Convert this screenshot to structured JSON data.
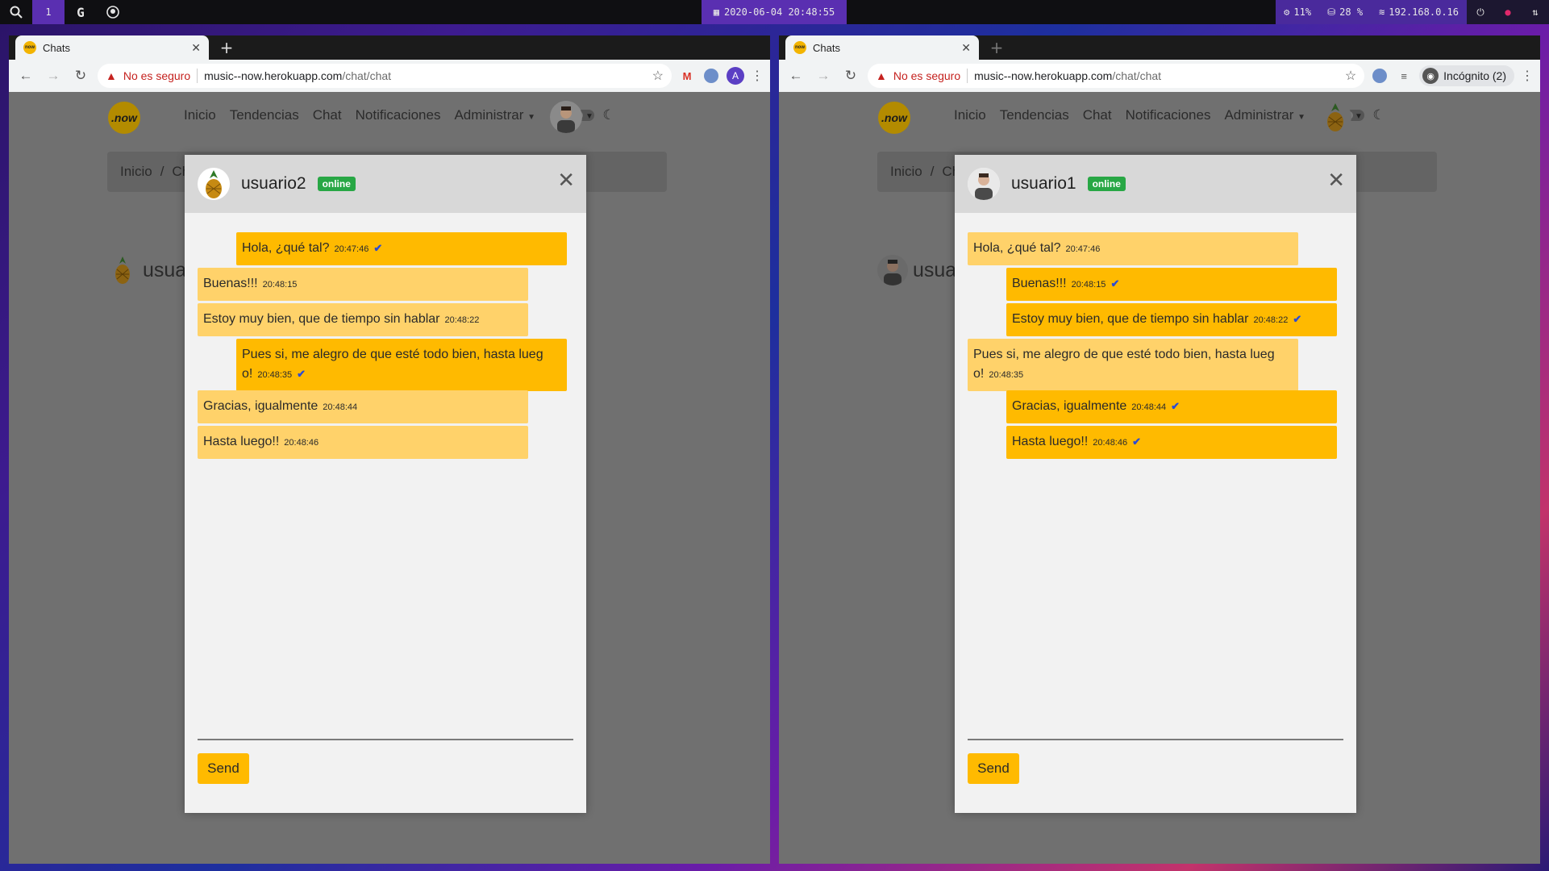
{
  "system_bar": {
    "workspace": "1",
    "datetime": "2020-06-04 20:48:55",
    "cpu": "11%",
    "disk": "28 %",
    "ip": "192.168.0.16"
  },
  "windows": [
    {
      "tab_title": "Chats",
      "insecure_label": "No es seguro",
      "url_host": "music--now.herokuapp.com",
      "url_path": "/chat/chat",
      "profile_initial": "A",
      "incognito_label": "",
      "site": {
        "logo_text": ".now",
        "nav": [
          "Inicio",
          "Tendencias",
          "Chat",
          "Notificaciones",
          "Administrar"
        ],
        "breadcrumb": [
          "Inicio",
          "Ch"
        ],
        "bg_user_partial": "usua"
      },
      "chat": {
        "username": "usuario2",
        "status": "online",
        "send_label": "Send",
        "messages": [
          {
            "text": "Hola, ¿qué tal?",
            "time": "20:47:46",
            "dir": "out"
          },
          {
            "text": "Buenas!!!",
            "time": "20:48:15",
            "dir": "in"
          },
          {
            "text": "Estoy muy bien, que de tiempo sin hablar",
            "time": "20:48:22",
            "dir": "in"
          },
          {
            "text": "Pues si, me alegro de que esté todo bien, hasta lueg o!",
            "time": "20:48:35",
            "dir": "out"
          },
          {
            "text": "Gracias, igualmente",
            "time": "20:48:44",
            "dir": "in"
          },
          {
            "text": "Hasta luego!!",
            "time": "20:48:46",
            "dir": "in"
          }
        ]
      }
    },
    {
      "tab_title": "Chats",
      "insecure_label": "No es seguro",
      "url_host": "music--now.herokuapp.com",
      "url_path": "/chat/chat",
      "profile_initial": "",
      "incognito_label": "Incógnito (2)",
      "site": {
        "logo_text": ".now",
        "nav": [
          "Inicio",
          "Tendencias",
          "Chat",
          "Notificaciones",
          "Administrar"
        ],
        "breadcrumb": [
          "Inicio",
          "Ch"
        ],
        "bg_user_partial": "usua"
      },
      "chat": {
        "username": "usuario1",
        "status": "online",
        "send_label": "Send",
        "messages": [
          {
            "text": "Hola, ¿qué tal?",
            "time": "20:47:46",
            "dir": "in"
          },
          {
            "text": "Buenas!!!",
            "time": "20:48:15",
            "dir": "out"
          },
          {
            "text": "Estoy muy bien, que de tiempo sin hablar",
            "time": "20:48:22",
            "dir": "out"
          },
          {
            "text": "Pues si, me alegro de que esté todo bien, hasta lueg o!",
            "time": "20:48:35",
            "dir": "in"
          },
          {
            "text": "Gracias, igualmente",
            "time": "20:48:44",
            "dir": "out"
          },
          {
            "text": "Hasta luego!!",
            "time": "20:48:46",
            "dir": "out"
          }
        ]
      }
    }
  ],
  "colors": {
    "accent": "#ffba00",
    "incoming_bubble": "#ffd26a",
    "online_badge": "#28a745",
    "read_check": "#2b4bd4"
  }
}
